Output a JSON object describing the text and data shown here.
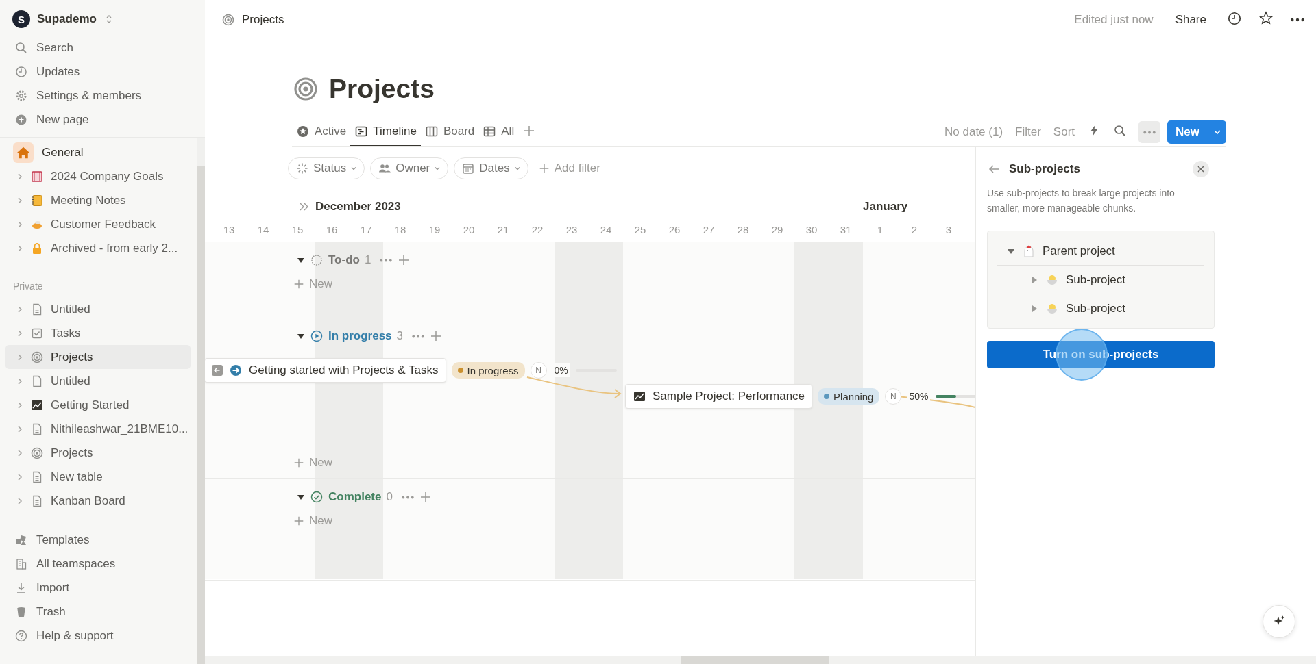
{
  "sidebar": {
    "workspace": {
      "initial": "S",
      "name": "Supademo"
    },
    "actions": [
      {
        "label": "Search",
        "kind": "search"
      },
      {
        "label": "Updates",
        "kind": "clock"
      },
      {
        "label": "Settings & members",
        "kind": "gear"
      },
      {
        "label": "New page",
        "kind": "plus"
      }
    ],
    "teamspace": {
      "label": "General",
      "kind": "home"
    },
    "team_pages": [
      {
        "label": "2024 Company Goals",
        "kind": "book",
        "expanded": false,
        "selected": false
      },
      {
        "label": "Meeting Notes",
        "kind": "notebook",
        "expanded": false,
        "selected": false
      },
      {
        "label": "Customer Feedback",
        "kind": "dish",
        "expanded": false,
        "selected": false
      },
      {
        "label": "Archived - from early 2...",
        "kind": "lock",
        "expanded": false,
        "selected": false
      }
    ],
    "private_heading": "Private",
    "private_pages": [
      {
        "label": "Untitled",
        "kind": "page",
        "expanded": false,
        "selected": false
      },
      {
        "label": "Tasks",
        "kind": "checkbox",
        "expanded": false,
        "selected": false
      },
      {
        "label": "Projects",
        "kind": "target",
        "expanded": false,
        "selected": true
      },
      {
        "label": "Untitled",
        "kind": "blank",
        "expanded": false,
        "selected": false
      },
      {
        "label": "Getting Started",
        "kind": "chart",
        "expanded": false,
        "selected": false
      },
      {
        "label": "Nithileashwar_21BME10...",
        "kind": "page",
        "expanded": false,
        "selected": false
      },
      {
        "label": "Projects",
        "kind": "target",
        "expanded": false,
        "selected": false
      },
      {
        "label": "New table",
        "kind": "page",
        "expanded": false,
        "selected": false
      },
      {
        "label": "Kanban Board",
        "kind": "page",
        "expanded": false,
        "selected": false
      }
    ],
    "bottom": [
      {
        "label": "Templates",
        "kind": "shapes"
      },
      {
        "label": "All teamspaces",
        "kind": "building"
      },
      {
        "label": "Import",
        "kind": "download"
      },
      {
        "label": "Trash",
        "kind": "trash"
      },
      {
        "label": "Help & support",
        "kind": "help"
      }
    ]
  },
  "topbar": {
    "breadcrumb": "Projects",
    "edited": "Edited just now",
    "share": "Share"
  },
  "page": {
    "title": "Projects",
    "views": [
      {
        "label": "Active",
        "kind": "star",
        "selected": false
      },
      {
        "label": "Timeline",
        "kind": "timeline",
        "selected": true
      },
      {
        "label": "Board",
        "kind": "board",
        "selected": false
      },
      {
        "label": "All",
        "kind": "table",
        "selected": false
      }
    ],
    "no_date": "No date (1)",
    "filter": "Filter",
    "sort": "Sort",
    "new_button": "New"
  },
  "filters": [
    {
      "label": "Status",
      "kind": "status"
    },
    {
      "label": "Owner",
      "kind": "people"
    },
    {
      "label": "Dates",
      "kind": "calendar"
    }
  ],
  "add_filter": "Add filter",
  "timeline": {
    "months": [
      {
        "label": "December 2023",
        "days": [
          {
            "label": "13",
            "weekend": false
          },
          {
            "label": "14",
            "weekend": false
          },
          {
            "label": "15",
            "weekend": false
          },
          {
            "label": "16",
            "weekend": true
          },
          {
            "label": "17",
            "weekend": true
          },
          {
            "label": "18",
            "weekend": false
          },
          {
            "label": "19",
            "weekend": false
          },
          {
            "label": "20",
            "weekend": false
          },
          {
            "label": "21",
            "weekend": false
          },
          {
            "label": "22",
            "weekend": false
          },
          {
            "label": "23",
            "weekend": true
          },
          {
            "label": "24",
            "weekend": true
          },
          {
            "label": "25",
            "weekend": false
          },
          {
            "label": "26",
            "weekend": false
          },
          {
            "label": "27",
            "weekend": false
          },
          {
            "label": "28",
            "weekend": false
          },
          {
            "label": "29",
            "weekend": false
          },
          {
            "label": "30",
            "weekend": true
          },
          {
            "label": "31",
            "weekend": true
          }
        ]
      },
      {
        "label": "January",
        "days": [
          {
            "label": "1",
            "weekend": false
          },
          {
            "label": "2",
            "weekend": false
          },
          {
            "label": "3",
            "weekend": false
          }
        ]
      }
    ],
    "groups": [
      {
        "label": "To-do",
        "count": "1",
        "kind": "todo",
        "color": "#787774",
        "new_label": "New"
      },
      {
        "label": "In progress",
        "count": "3",
        "kind": "inprogress",
        "color": "#337ea9",
        "new_label": "New",
        "items": [
          {
            "title": "Getting started with Projects & Tasks",
            "kind": "arrow",
            "status": {
              "label": "In progress",
              "color": "#cb912f"
            },
            "owner": "N",
            "progress": "0%",
            "level": 0
          },
          {
            "title": "Sample Project: Performance",
            "kind": "chart",
            "status": {
              "label": "Planning",
              "color": "#5b97bd"
            },
            "owner": "N",
            "progress": "50%",
            "level": 0.5
          }
        ]
      },
      {
        "label": "Complete",
        "count": "0",
        "kind": "complete",
        "color": "#448361",
        "new_label": "New"
      }
    ]
  },
  "panel": {
    "title": "Sub-projects",
    "description": "Use sub-projects to break large projects into smaller, more manageable chunks.",
    "tree": {
      "label": "Parent project",
      "expanded": true,
      "children": [
        {
          "label": "Sub-project",
          "expanded": false
        },
        {
          "label": "Sub-project",
          "expanded": false
        }
      ]
    },
    "button": "Turn on sub-projects"
  }
}
